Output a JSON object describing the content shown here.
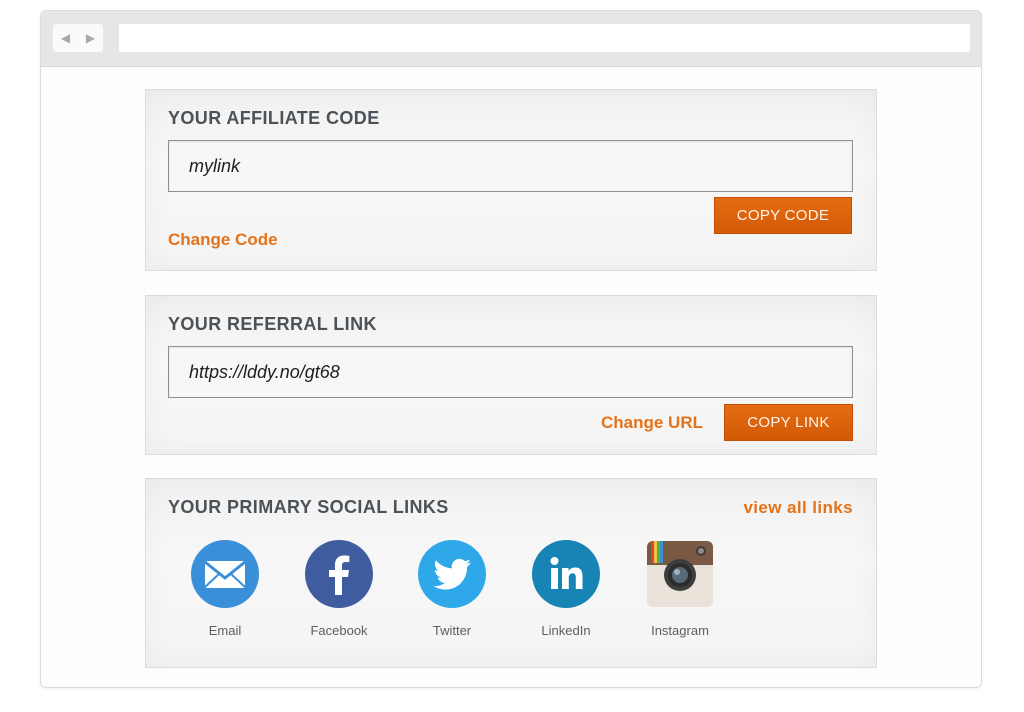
{
  "affiliate": {
    "title": "YOUR AFFILIATE CODE",
    "code_value": "mylink",
    "copy_label": "COPY CODE",
    "change_label": "Change Code"
  },
  "referral": {
    "title": "YOUR REFERRAL LINK",
    "link_value": "https://lddy.no/gt68",
    "change_label": "Change URL",
    "copy_label": "COPY LINK"
  },
  "social": {
    "title": "YOUR PRIMARY SOCIAL LINKS",
    "view_all_label": "view all links",
    "items": [
      {
        "label": "Email",
        "icon": "email-icon",
        "color": "#3a8fd9"
      },
      {
        "label": "Facebook",
        "icon": "facebook-icon",
        "color": "#3f5d9e"
      },
      {
        "label": "Twitter",
        "icon": "twitter-icon",
        "color": "#2ea8e8"
      },
      {
        "label": "LinkedIn",
        "icon": "linkedin-icon",
        "color": "#1883b5"
      },
      {
        "label": "Instagram",
        "icon": "instagram-icon",
        "color": "#7a5a45"
      }
    ]
  },
  "colors": {
    "accent_orange": "#e4731a",
    "button_orange": "#d35a06",
    "title_gray": "#4b5258"
  }
}
